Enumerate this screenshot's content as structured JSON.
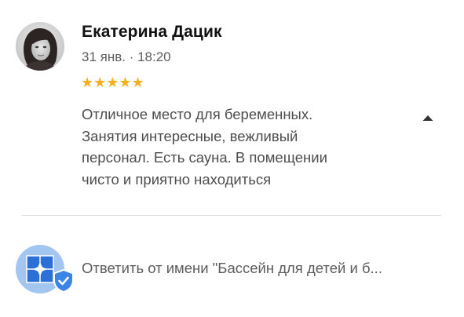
{
  "review": {
    "author_name": "Екатерина Дацик",
    "date": "31 янв. · 18:20",
    "rating_stars": "★★★★★",
    "rating_value": 5,
    "rating_max": 5,
    "text_lines": [
      "Отличное место для беременных.",
      "Занятия интересные, вежливый",
      "персонал. Есть сауна. В помещении",
      "чисто и приятно находиться"
    ]
  },
  "reply": {
    "label": "Ответить от имени \"Бассейн для детей и б..."
  },
  "colors": {
    "star": "#f2b01e",
    "org_avatar_bg": "#a3c6f1",
    "verified_badge": "#3c84e6"
  },
  "icons": {
    "collapse": "chevron-up-icon",
    "verified": "verified-badge-icon"
  }
}
